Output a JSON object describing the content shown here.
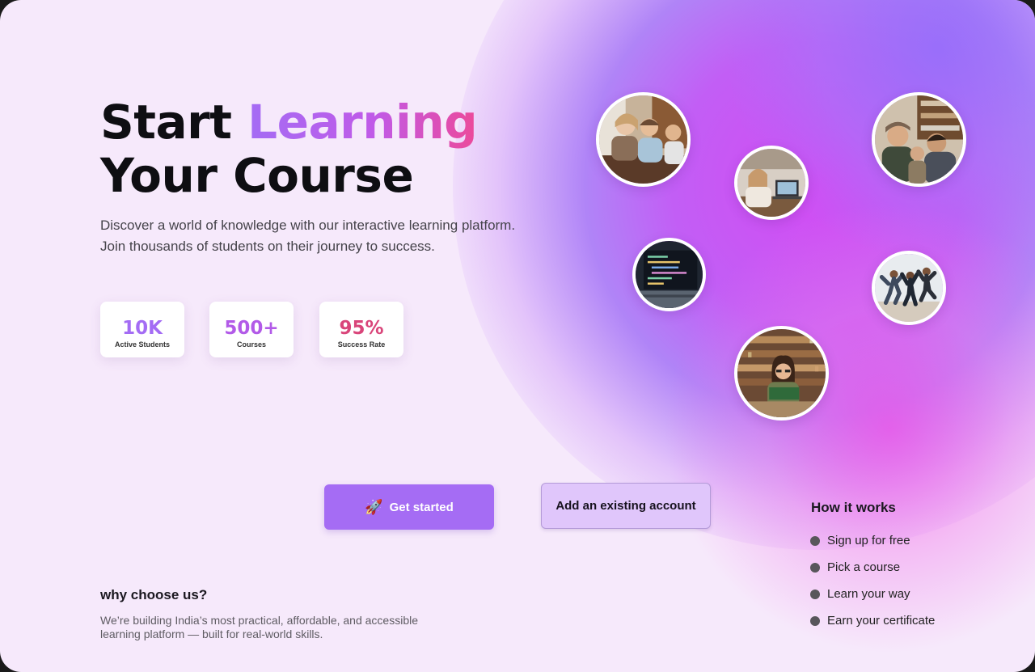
{
  "hero": {
    "title_word1": "Start",
    "title_accent": "Learning",
    "title_line2": "Your Course",
    "subtitle_line1": "Discover a world of knowledge with our interactive learning platform.",
    "subtitle_line2": "Join thousands of students on their journey to success."
  },
  "stats": [
    {
      "value": "10K",
      "label": "Active Students",
      "color": "#a46cf4"
    },
    {
      "value": "500+",
      "label": "Courses",
      "color": "#b25ae8"
    },
    {
      "value": "95%",
      "label": "Success Rate",
      "color": "#d9457a"
    }
  ],
  "photos": [
    {
      "icon": "photo-group-laughing"
    },
    {
      "icon": "photo-laptop-cafe"
    },
    {
      "icon": "photo-team-discussion"
    },
    {
      "icon": "photo-code-screen"
    },
    {
      "icon": "photo-people-jumping"
    },
    {
      "icon": "photo-girl-reading-library"
    }
  ],
  "actions": {
    "primary_icon": "rocket-icon",
    "primary_label": "Get started",
    "secondary_label": "Add an existing account"
  },
  "how_it_works": {
    "title": "How it works",
    "steps": [
      "Sign up for free",
      "Pick a course",
      "Learn your way",
      "Earn your certificate"
    ]
  },
  "why": {
    "title": "why choose us?",
    "text_line1": "We’re building India’s most practical, affordable, and accessible",
    "text_line2": "learning platform — built for real-world skills."
  },
  "colors": {
    "accent_purple": "#a56cf4",
    "accent_pink": "#ec4a9a",
    "background": "#f6e9fb"
  }
}
